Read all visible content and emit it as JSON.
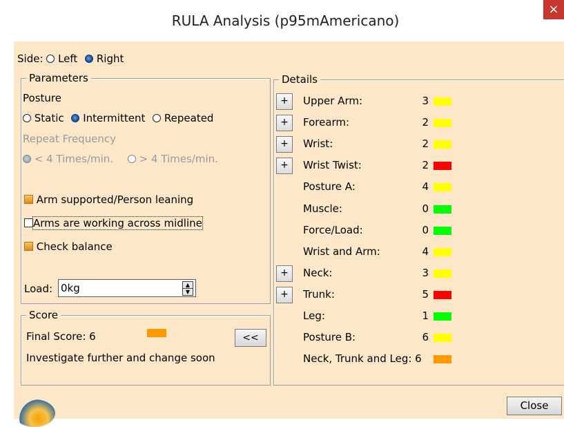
{
  "window": {
    "title": "RULA Analysis (p95mAmericano)",
    "close_glyph": "×"
  },
  "side": {
    "label": "Side:",
    "options": [
      "Left",
      "Right"
    ],
    "selected": "Right"
  },
  "parameters": {
    "legend": "Parameters",
    "posture_label": "Posture",
    "posture_options": [
      "Static",
      "Intermittent",
      "Repeated"
    ],
    "posture_selected": "Intermittent",
    "repeat_label": "Repeat Frequency",
    "repeat_options": [
      "< 4 Times/min.",
      "> 4 Times/min."
    ],
    "repeat_selected": "< 4 Times/min.",
    "checkboxes": [
      {
        "label": "Arm supported/Person leaning",
        "checked": true
      },
      {
        "label": "Arms are working across midline",
        "checked": false
      },
      {
        "label": "Check balance",
        "checked": true
      }
    ],
    "load_label": "Load:",
    "load_value": "0kg"
  },
  "score": {
    "legend": "Score",
    "final_score": "Final Score: 6",
    "final_color": "#ff9900",
    "message": "Investigate further and change soon",
    "collapse_label": "<<"
  },
  "details": {
    "legend": "Details",
    "expand_label": "+",
    "rows": [
      {
        "label": "Upper Arm:",
        "value": "3",
        "color": "#ffff00",
        "expandable": true
      },
      {
        "label": "Forearm:",
        "value": "2",
        "color": "#ffff00",
        "expandable": true
      },
      {
        "label": "Wrist:",
        "value": "2",
        "color": "#ffff00",
        "expandable": true
      },
      {
        "label": "Wrist Twist:",
        "value": "2",
        "color": "#ff0000",
        "expandable": true
      },
      {
        "label": "Posture A:",
        "value": "4",
        "color": "#ffff00",
        "expandable": false
      },
      {
        "label": "Muscle:",
        "value": "0",
        "color": "#00ff00",
        "expandable": false
      },
      {
        "label": "Force/Load:",
        "value": "0",
        "color": "#00ff00",
        "expandable": false
      },
      {
        "label": "Wrist and Arm:",
        "value": "4",
        "color": "#ffff00",
        "expandable": false
      },
      {
        "label": "Neck:",
        "value": "3",
        "color": "#ffff00",
        "expandable": true
      },
      {
        "label": "Trunk:",
        "value": "5",
        "color": "#ff0000",
        "expandable": true
      },
      {
        "label": "Leg:",
        "value": "1",
        "color": "#00ff00",
        "expandable": false
      },
      {
        "label": "Posture B:",
        "value": "6",
        "color": "#ffff00",
        "expandable": false
      },
      {
        "label": "Neck, Trunk and Leg: 6",
        "value": "",
        "color": "#ff9900",
        "expandable": false
      }
    ]
  },
  "footer": {
    "close_label": "Close"
  }
}
